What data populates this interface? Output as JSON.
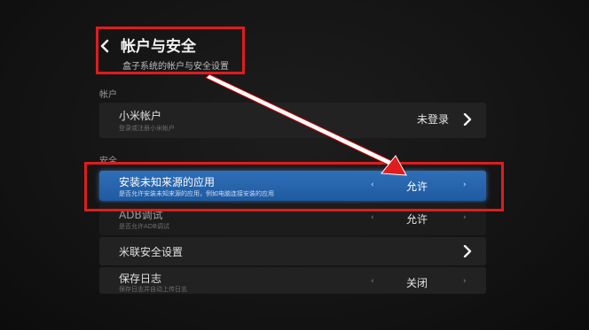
{
  "header": {
    "title": "帐户与安全",
    "subtitle": "盒子系统的帐户与安全设置"
  },
  "sections": {
    "account": "帐户",
    "security": "安全"
  },
  "rows": {
    "mi_account": {
      "label": "小米帐户",
      "desc": "登录或注册小米帐户",
      "value": "未登录"
    },
    "unknown_sources": {
      "label": "安装未知来源的应用",
      "desc": "是否允许安装未知来源的应用，例如电脑连接安装的应用",
      "value": "允许"
    },
    "adb": {
      "label": "ADB调试",
      "desc": "是否允许ADB调试",
      "value": "允许"
    },
    "milian": {
      "label": "米联安全设置"
    },
    "save_log": {
      "label": "保存日志",
      "desc": "保存日志并自动上传日志",
      "value": "关闭"
    }
  },
  "glyphs": {
    "left": "‹",
    "right": "›"
  },
  "colors": {
    "annotation": "#e01c1c",
    "selected": "#2f6fb8"
  },
  "icons": [
    "back-icon",
    "chevron-right-icon",
    "annotation-arrow"
  ]
}
